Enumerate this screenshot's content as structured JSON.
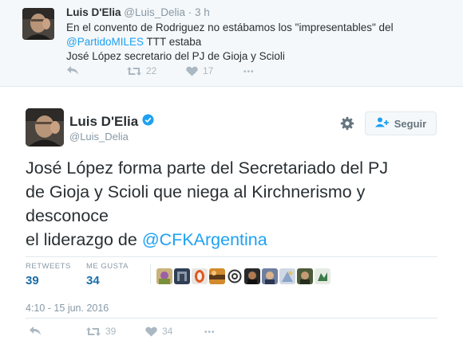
{
  "reply_tweet": {
    "name": "Luis D'Elia",
    "handle": "@Luis_Delia",
    "separator": "·",
    "time": "3 h",
    "line1": "En el convento de Rodriguez no estábamos los \"impresentables\" del",
    "mention": "@PartidoMILES",
    "line2_rest": " TTT estaba",
    "line3": "José López secretario del PJ de Gioja y Scioli",
    "retweets": "22",
    "likes": "17",
    "more_label": "•••"
  },
  "main_tweet": {
    "name": "Luis D'Elia",
    "handle": "@Luis_Delia",
    "follow_label": "Seguir",
    "text_line1": "José López forma parte del Secretariado del PJ",
    "text_line2": "de Gioja y Scioli que niega al Kirchnerismo y",
    "text_line3": "desconoce",
    "text_line4_prefix": "el liderazgo de ",
    "text_mention": "@CFKArgentina",
    "retweets_label": "RETWEETS",
    "retweets": "39",
    "likes_label": "ME GUSTA",
    "likes": "34",
    "timestamp": "4:10 - 15 jun. 2016",
    "action_retweets": "39",
    "action_likes": "34",
    "more_label": "•••"
  },
  "colors": {
    "link": "#1da1f2",
    "verified": "#1da1f2",
    "icon_gray": "#aab8c2",
    "stat_number": "#1b6fa8",
    "reply_bg": "#f5f8fa"
  },
  "icons": [
    "reply-icon",
    "retweet-icon",
    "heart-icon",
    "more-icon",
    "gear-icon",
    "follow-icon",
    "verified-icon"
  ]
}
